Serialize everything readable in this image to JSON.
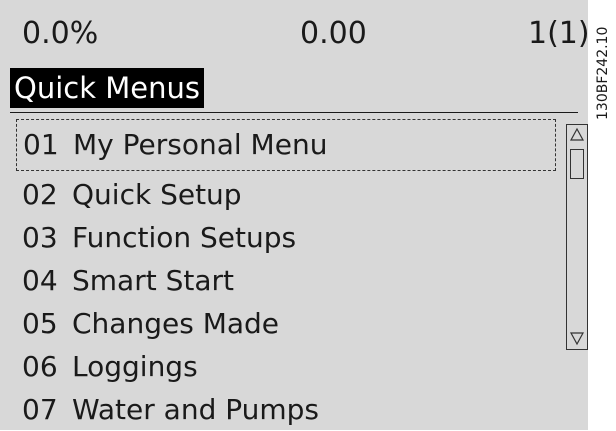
{
  "status": {
    "left": "0.0%",
    "center": "0.00",
    "right": "1(1)"
  },
  "title": "Quick Menus",
  "menu": [
    {
      "num": "01",
      "label": "My Personal Menu",
      "selected": true
    },
    {
      "num": "02",
      "label": "Quick Setup",
      "selected": false
    },
    {
      "num": "03",
      "label": "Function Setups",
      "selected": false
    },
    {
      "num": "04",
      "label": "Smart Start",
      "selected": false
    },
    {
      "num": "05",
      "label": "Changes Made",
      "selected": false
    },
    {
      "num": "06",
      "label": "Loggings",
      "selected": false
    },
    {
      "num": "07",
      "label": "Water and Pumps",
      "selected": false
    }
  ],
  "side_code": "130BF242.10",
  "icons": {
    "scroll_up": "triangle-up-icon",
    "scroll_down": "triangle-down-icon"
  },
  "colors": {
    "screen_background": "#d8d8d8",
    "title_background": "#000000",
    "title_text": "#ffffff",
    "text": "#1a1a1a"
  }
}
